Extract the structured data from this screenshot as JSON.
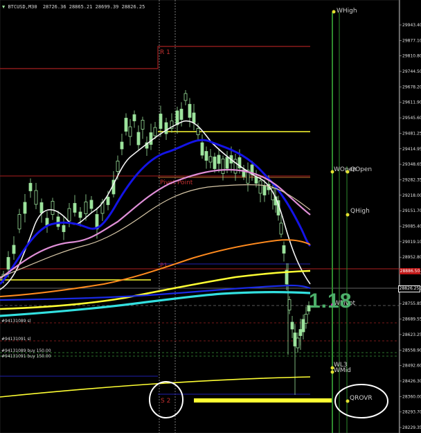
{
  "chart": {
    "symbol": "BTCUSD,M30",
    "ohlc": "28726.36 28865.21 28699.39 28826.25"
  },
  "price_axis": {
    "ticks": [
      "29943.40",
      "29877.10",
      "29810.80",
      "29744.50",
      "29678.20",
      "29611.90",
      "29545.60",
      "29481.25",
      "29414.95",
      "29348.65",
      "29282.35",
      "29218.00",
      "29151.70",
      "29085.40",
      "29019.10",
      "28952.80",
      "28886.50",
      "28820.20",
      "28755.85",
      "28689.55",
      "28623.25",
      "28558.90",
      "28492.60",
      "28426.30",
      "28360.00",
      "28293.70",
      "28229.35"
    ],
    "current_price": "28826.25",
    "red_tag": "28886.50"
  },
  "levels": {
    "r1": "R 1",
    "pivot": "Pivot Point",
    "p1": "P1",
    "s2": "S 2"
  },
  "markers": {
    "w_high": "WHigh",
    "w_open": "WOpen",
    "q_open": "QOpen",
    "q_high": "QHigh",
    "w_pivot": "WPivot",
    "wl3": "WL3",
    "w_mid": "WMid",
    "q_rovr": "QROVR"
  },
  "orders": {
    "sl1": "#94131089 sl",
    "sl2": "#94131091 sl",
    "buy1": "#94131089 buy 150.00",
    "buy2": "#94131091 buy 150.00"
  },
  "big_value": "1.18",
  "colors": {
    "background": "#000000",
    "up_candle": "#9ce39c",
    "resistance": "#8b1a1a",
    "yellow": "#ffff33",
    "blue_ma": "#1414e6",
    "pink_ma": "#e08fd8",
    "white_ma": "#f4f4f4",
    "orange_ma": "#ff8a1e",
    "cyan_ma": "#33e0e0",
    "green_value": "#4caf6a"
  }
}
